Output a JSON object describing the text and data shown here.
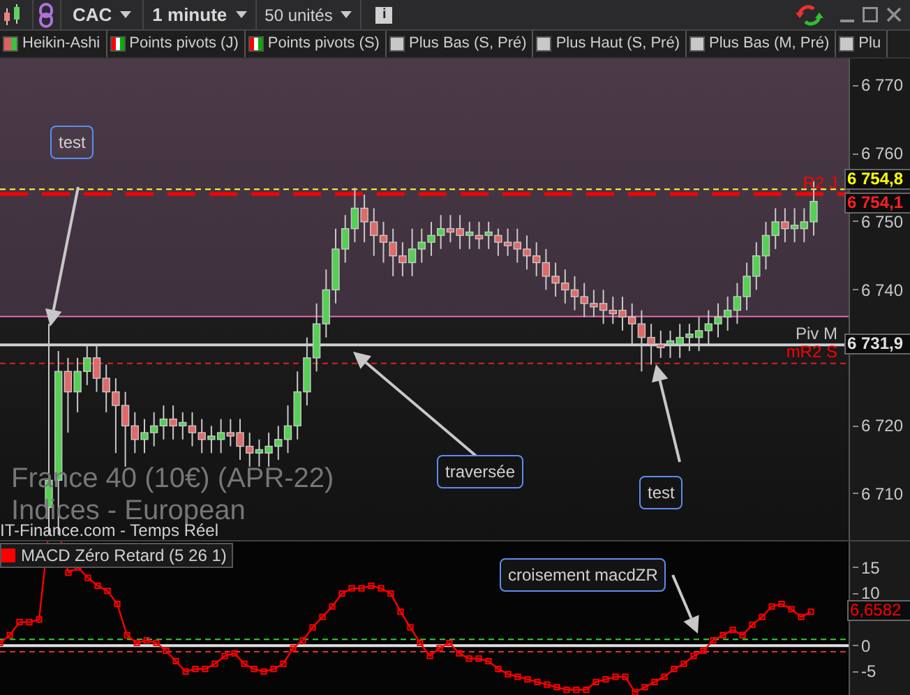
{
  "toolbar": {
    "symbol": "CAC",
    "interval": "1 minute",
    "units": "50 unités",
    "info_button": "i"
  },
  "indicators": [
    {
      "label": "Heikin-Ashi",
      "kind": "candles"
    },
    {
      "label": "Points pivots (J)",
      "kind": "pivot"
    },
    {
      "label": "Points pivots (S)",
      "kind": "pivot"
    },
    {
      "label": "Plus Bas (S, Pré)",
      "kind": "plain"
    },
    {
      "label": "Plus Haut (S, Pré)",
      "kind": "plain"
    },
    {
      "label": "Plus Bas (M, Pré)",
      "kind": "plain"
    },
    {
      "label": "Plu",
      "kind": "plain"
    }
  ],
  "price_chart": {
    "instrument": "France 40 (10€) (APR-22)",
    "market": "Indices - European",
    "source": "IT-Finance.com - Temps Réel",
    "annotations": [
      {
        "text": "test"
      },
      {
        "text": "traversée"
      },
      {
        "text": "test"
      }
    ],
    "line_labels": [
      {
        "text": "R2 J",
        "color": "#ff0000"
      },
      {
        "text": "Piv M",
        "color": "#c8c8c8"
      },
      {
        "text": "mR2 S",
        "color": "#ff0000"
      }
    ],
    "price_tags": [
      {
        "text": "6 754,8",
        "color": "#ffff00"
      },
      {
        "text": "6 754,1",
        "color": "#ff2020"
      },
      {
        "text": "6 731,9",
        "color": "#e0e0e0"
      }
    ],
    "chart_data": {
      "type": "candlestick",
      "ylim": [
        6703,
        6774
      ],
      "yticks": [
        {
          "value": 6770,
          "label": "6 770"
        },
        {
          "value": 6760,
          "label": "6 760"
        },
        {
          "value": 6750,
          "label": "6 750"
        },
        {
          "value": 6740,
          "label": "6 740"
        },
        {
          "value": 6720,
          "label": "6 720"
        },
        {
          "value": 6710,
          "label": "6 710"
        }
      ],
      "ref_lines": [
        {
          "axis": "y",
          "value": 6736.1,
          "color": "#f070c0"
        },
        {
          "axis": "y",
          "value": 6731.9,
          "color": "#d0d0d0"
        },
        {
          "axis": "y",
          "value": 6729.2,
          "color": "#e02020"
        },
        {
          "axis": "y",
          "value": 6754.1,
          "color": "#ff0000"
        },
        {
          "axis": "y",
          "value": 6754.8,
          "color": "#ffff40"
        }
      ],
      "ohlc": [
        [
          6708,
          6735,
          6704,
          6712
        ],
        [
          6712,
          6731,
          6704,
          6728
        ],
        [
          6728,
          6730,
          6719,
          6725
        ],
        [
          6725,
          6730,
          6722,
          6728
        ],
        [
          6728,
          6732,
          6726,
          6730
        ],
        [
          6730,
          6732,
          6725,
          6727
        ],
        [
          6727,
          6729,
          6722,
          6725
        ],
        [
          6725,
          6727,
          6716,
          6723
        ],
        [
          6723,
          6725,
          6714,
          6720
        ],
        [
          6720,
          6722,
          6716,
          6718
        ],
        [
          6718,
          6721,
          6716,
          6719
        ],
        [
          6719,
          6722,
          6717,
          6720
        ],
        [
          6720,
          6723,
          6718,
          6721
        ],
        [
          6721,
          6723,
          6718,
          6720
        ],
        [
          6720,
          6722,
          6718,
          6720.5
        ],
        [
          6720,
          6722,
          6717,
          6719
        ],
        [
          6719,
          6721,
          6716,
          6718
        ],
        [
          6718,
          6720,
          6716,
          6718.5
        ],
        [
          6718,
          6721,
          6716,
          6719
        ],
        [
          6719,
          6721,
          6717,
          6718.5
        ],
        [
          6719,
          6721,
          6715,
          6717
        ],
        [
          6717,
          6719,
          6714,
          6716
        ],
        [
          6716,
          6718,
          6714,
          6716.5
        ],
        [
          6716,
          6719,
          6714,
          6717
        ],
        [
          6717,
          6720,
          6715,
          6718
        ],
        [
          6718,
          6723,
          6716,
          6720
        ],
        [
          6720,
          6728,
          6718,
          6725
        ],
        [
          6725,
          6733,
          6723,
          6730
        ],
        [
          6730,
          6738,
          6728,
          6735
        ],
        [
          6735,
          6743,
          6733,
          6740
        ],
        [
          6740,
          6749,
          6738,
          6746
        ],
        [
          6746,
          6751,
          6744,
          6749
        ],
        [
          6749,
          6755,
          6747,
          6752
        ],
        [
          6752,
          6754,
          6747,
          6750
        ],
        [
          6750,
          6752,
          6745,
          6748
        ],
        [
          6748,
          6750,
          6744,
          6747
        ],
        [
          6747,
          6749,
          6742,
          6745
        ],
        [
          6745,
          6747,
          6742,
          6744
        ],
        [
          6744,
          6749,
          6742,
          6746
        ],
        [
          6746,
          6749,
          6744,
          6747
        ],
        [
          6747,
          6750,
          6745,
          6748
        ],
        [
          6748,
          6751,
          6746,
          6749
        ],
        [
          6749,
          6751,
          6747,
          6748.5
        ],
        [
          6749,
          6751,
          6746,
          6748
        ],
        [
          6748,
          6750,
          6746,
          6748.5
        ],
        [
          6748,
          6750,
          6746,
          6747.5
        ],
        [
          6748,
          6750,
          6746,
          6748.5
        ],
        [
          6748,
          6749,
          6745,
          6747
        ],
        [
          6747,
          6749,
          6745,
          6746.5
        ],
        [
          6747,
          6749,
          6744,
          6746
        ],
        [
          6746,
          6748,
          6743,
          6745
        ],
        [
          6745,
          6747,
          6742,
          6744
        ],
        [
          6744,
          6746,
          6740,
          6742
        ],
        [
          6742,
          6744,
          6739,
          6741
        ],
        [
          6741,
          6743,
          6738,
          6740
        ],
        [
          6740,
          6742,
          6737,
          6739
        ],
        [
          6739,
          6741,
          6736,
          6738
        ],
        [
          6738,
          6740,
          6736,
          6737.5
        ],
        [
          6738,
          6740,
          6735,
          6737
        ],
        [
          6737,
          6739,
          6735,
          6736.5
        ],
        [
          6737,
          6739,
          6734,
          6736
        ],
        [
          6736,
          6738,
          6732,
          6735
        ],
        [
          6735,
          6737,
          6728,
          6733
        ],
        [
          6733,
          6735,
          6729,
          6732
        ],
        [
          6732,
          6734,
          6730,
          6731.5
        ],
        [
          6732,
          6734,
          6730,
          6732.5
        ],
        [
          6732,
          6735,
          6730,
          6733
        ],
        [
          6733,
          6735,
          6731,
          6733.5
        ],
        [
          6733,
          6736,
          6731,
          6734
        ],
        [
          6734,
          6737,
          6732,
          6735
        ],
        [
          6735,
          6738,
          6733,
          6736
        ],
        [
          6736,
          6739,
          6734,
          6737
        ],
        [
          6737,
          6741,
          6735,
          6739
        ],
        [
          6739,
          6744,
          6737,
          6742
        ],
        [
          6742,
          6747,
          6740,
          6745
        ],
        [
          6745,
          6750,
          6743,
          6748
        ],
        [
          6748,
          6752,
          6746,
          6750
        ],
        [
          6750,
          6752,
          6747,
          6749
        ],
        [
          6749,
          6752,
          6747,
          6749.5
        ],
        [
          6749,
          6752,
          6747,
          6750
        ],
        [
          6750,
          6756,
          6748,
          6753
        ]
      ]
    }
  },
  "macd_panel": {
    "annotation": "croisement macdZR",
    "value_tag": "6,6582",
    "chart_data": {
      "type": "line",
      "ylim": [
        -9.5,
        20
      ],
      "yticks": [
        15,
        10,
        0,
        -5
      ],
      "ref_lines": [
        {
          "axis": "y",
          "value": 1.2,
          "color": "#30d030"
        },
        {
          "axis": "y",
          "value": 0,
          "color": "#e0e0e0"
        },
        {
          "axis": "y",
          "value": -1.2,
          "color": "#e03030"
        }
      ],
      "series": [
        {
          "name": "MACD Zéro Retard (5 26 1)",
          "color": "#ff0000",
          "values": [
            0.5,
            2,
            4.5,
            4.5,
            5,
            null,
            null,
            14,
            15,
            13,
            11.5,
            10.5,
            8,
            2,
            0.5,
            1,
            0.5,
            -1,
            -3,
            -5,
            -4.5,
            -4.5,
            -3.5,
            -2,
            -1.5,
            -3.5,
            -4.5,
            -5,
            -4.5,
            -3.5,
            -0.5,
            1,
            3.5,
            5.5,
            7.5,
            10,
            11,
            11,
            11.5,
            11,
            10,
            6.5,
            3.5,
            0.5,
            -2,
            -0.5,
            0.5,
            -1.5,
            -2.5,
            -2.5,
            -3,
            -4.5,
            -5.5,
            -6,
            -6.5,
            -7,
            -7.5,
            -8,
            -8.5,
            -8.5,
            -8.5,
            -7,
            -6.5,
            -6,
            -6,
            -9,
            -8,
            -7,
            -6,
            -4.5,
            -3.5,
            -2,
            -1,
            1,
            2,
            3,
            2,
            4,
            5.5,
            7.5,
            8,
            7,
            5.5,
            6.5
          ]
        }
      ]
    }
  }
}
